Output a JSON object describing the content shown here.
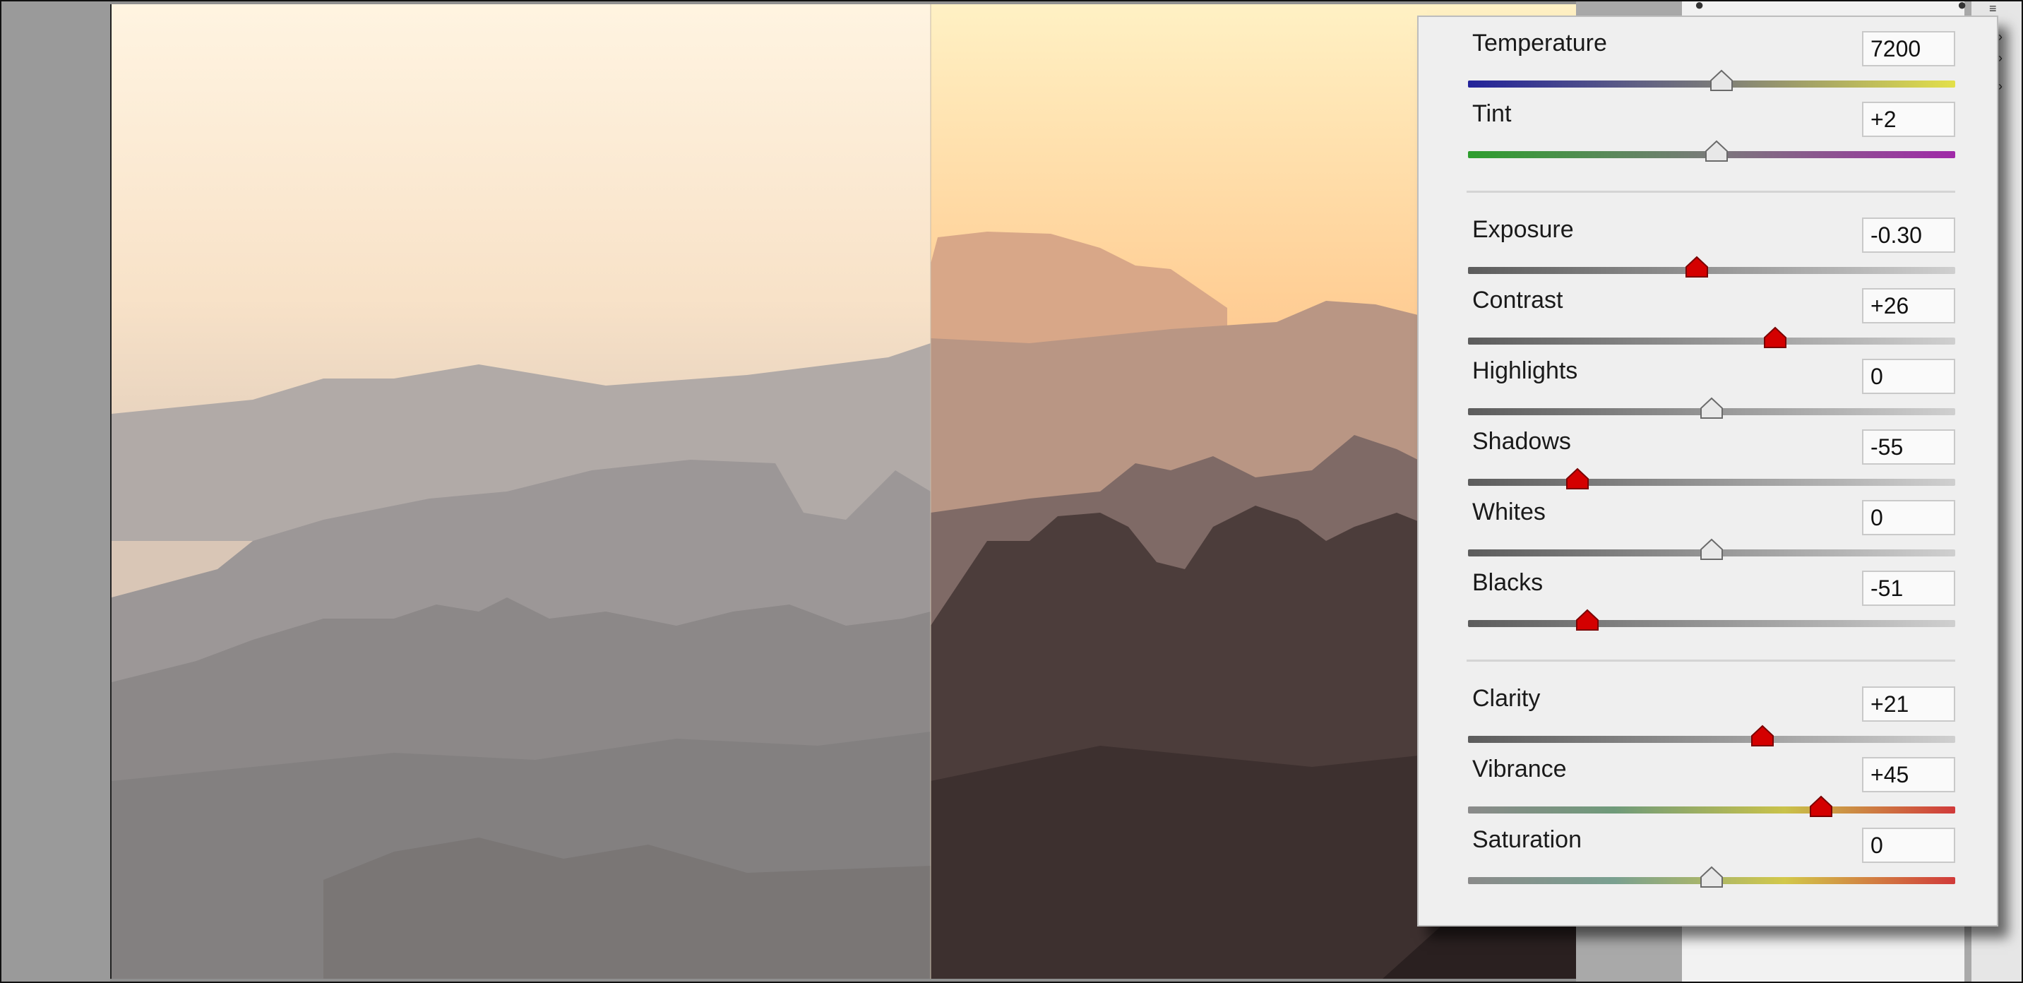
{
  "panel": {
    "sliders": [
      {
        "label": "Temperature",
        "value": "7200",
        "level": 0.52,
        "changed": false,
        "track": "temperature"
      },
      {
        "label": "Tint",
        "value": "+2",
        "level": 0.51,
        "changed": false,
        "track": "tint"
      },
      {
        "label": "Exposure",
        "value": "-0.30",
        "level": 0.47,
        "changed": true,
        "track": "gray"
      },
      {
        "label": "Contrast",
        "value": "+26",
        "level": 0.63,
        "changed": true,
        "track": "gray"
      },
      {
        "label": "Highlights",
        "value": "0",
        "level": 0.5,
        "changed": false,
        "track": "gray"
      },
      {
        "label": "Shadows",
        "value": "-55",
        "level": 0.225,
        "changed": true,
        "track": "gray"
      },
      {
        "label": "Whites",
        "value": "0",
        "level": 0.5,
        "changed": false,
        "track": "gray"
      },
      {
        "label": "Blacks",
        "value": "-51",
        "level": 0.245,
        "changed": true,
        "track": "gray"
      },
      {
        "label": "Clarity",
        "value": "+21",
        "level": 0.605,
        "changed": true,
        "track": "gray"
      },
      {
        "label": "Vibrance",
        "value": "+45",
        "level": 0.725,
        "changed": true,
        "track": "vibrance"
      },
      {
        "label": "Saturation",
        "value": "0",
        "level": 0.5,
        "changed": false,
        "track": "saturation"
      }
    ]
  },
  "colors": {
    "changed_thumb": "#d40000",
    "neutral_thumb": "#e8e8e8",
    "panel_bg": "#efefef"
  },
  "photo": {
    "description_icon": "mountain-landscape-before-after"
  }
}
